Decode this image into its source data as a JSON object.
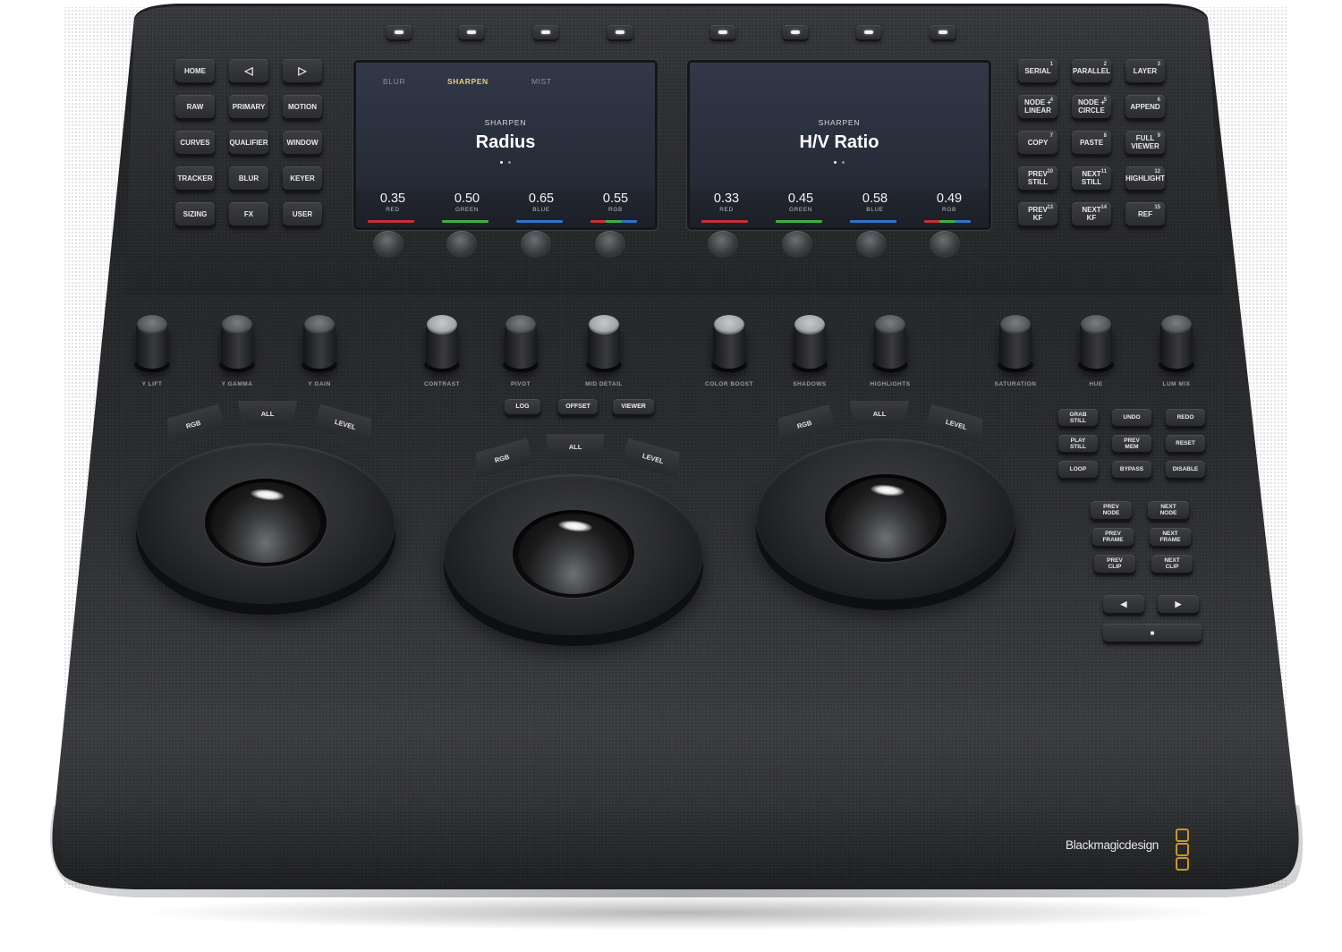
{
  "device": {
    "brand": "Blackmagicdesign",
    "brand_accent_color": "#c9962b",
    "chassis_color": "#2d2e31"
  },
  "top_softkeys": [
    {
      "id": "softkey-1"
    },
    {
      "id": "softkey-2"
    },
    {
      "id": "softkey-3"
    },
    {
      "id": "softkey-4"
    },
    {
      "id": "softkey-5"
    },
    {
      "id": "softkey-6"
    },
    {
      "id": "softkey-7"
    },
    {
      "id": "softkey-8"
    }
  ],
  "left_keypad": [
    {
      "label": "HOME"
    },
    {
      "label": "◁",
      "icon": "left-triangle-icon"
    },
    {
      "label": "▷",
      "icon": "right-triangle-icon"
    },
    {
      "label": "RAW"
    },
    {
      "label": "PRIMARY"
    },
    {
      "label": "MOTION"
    },
    {
      "label": "CURVES"
    },
    {
      "label": "QUALIFIER"
    },
    {
      "label": "WINDOW"
    },
    {
      "label": "TRACKER"
    },
    {
      "label": "BLUR"
    },
    {
      "label": "KEYER"
    },
    {
      "label": "SIZING"
    },
    {
      "label": "FX"
    },
    {
      "label": "USER"
    }
  ],
  "right_keypad": [
    {
      "label": "SERIAL",
      "num": "1"
    },
    {
      "label": "PARALLEL",
      "num": "2"
    },
    {
      "label": "LAYER",
      "num": "3"
    },
    {
      "label": "NODE +\nLINEAR",
      "num": "4"
    },
    {
      "label": "NODE +\nCIRCLE",
      "num": "5"
    },
    {
      "label": "APPEND",
      "num": "6"
    },
    {
      "label": "COPY",
      "num": "7"
    },
    {
      "label": "PASTE",
      "num": "8"
    },
    {
      "label": "FULL\nVIEWER",
      "num": "9"
    },
    {
      "label": "PREV\nSTILL",
      "num": "10"
    },
    {
      "label": "NEXT\nSTILL",
      "num": "11"
    },
    {
      "label": "HIGHLIGHT",
      "num": "12"
    },
    {
      "label": "PREV\nKF",
      "num": "13"
    },
    {
      "label": "NEXT\nKF",
      "num": "14"
    },
    {
      "label": "REF",
      "num": "15"
    }
  ],
  "screens": [
    {
      "tabs": [
        {
          "label": "BLUR",
          "active": false
        },
        {
          "label": "SHARPEN",
          "active": true
        },
        {
          "label": "MIST",
          "active": false
        }
      ],
      "category": "SHARPEN",
      "parameter": "Radius",
      "page_dots": 2,
      "active_page": 1,
      "values": [
        {
          "value": "0.35",
          "channel": "RED"
        },
        {
          "value": "0.50",
          "channel": "GREEN"
        },
        {
          "value": "0.65",
          "channel": "BLUE"
        },
        {
          "value": "0.55",
          "channel": "RGB"
        }
      ]
    },
    {
      "tabs": [],
      "category": "SHARPEN",
      "parameter": "H/V Ratio",
      "page_dots": 2,
      "active_page": 1,
      "values": [
        {
          "value": "0.33",
          "channel": "RED"
        },
        {
          "value": "0.45",
          "channel": "GREEN"
        },
        {
          "value": "0.58",
          "channel": "BLUE"
        },
        {
          "value": "0.49",
          "channel": "RGB"
        }
      ]
    }
  ],
  "channel_colors": {
    "RED": "#c4313a",
    "GREEN": "#3fae3f",
    "BLUE": "#2f74c8"
  },
  "knobs": [
    {
      "label": "Y LIFT"
    },
    {
      "label": "Y GAMMA"
    },
    {
      "label": "Y GAIN"
    },
    {
      "label": "CONTRAST"
    },
    {
      "label": "PIVOT"
    },
    {
      "label": "MID DETAIL"
    },
    {
      "label": "COLOR BOOST"
    },
    {
      "label": "SHADOWS"
    },
    {
      "label": "HIGHLIGHTS"
    },
    {
      "label": "SATURATION"
    },
    {
      "label": "HUE"
    },
    {
      "label": "LUM MIX"
    }
  ],
  "mode_keys": {
    "log": "LOG",
    "offset": "OFFSET",
    "viewer": "VIEWER"
  },
  "wheels": [
    {
      "name": "lift",
      "keys": [
        "RGB",
        "ALL",
        "LEVEL"
      ]
    },
    {
      "name": "gamma",
      "keys": [
        "RGB",
        "ALL",
        "LEVEL"
      ]
    },
    {
      "name": "gain",
      "keys": [
        "RGB",
        "ALL",
        "LEVEL"
      ]
    }
  ],
  "transport_keys": [
    {
      "label": "GRAB\nSTILL"
    },
    {
      "label": "UNDO"
    },
    {
      "label": "REDO"
    },
    {
      "label": "PLAY\nSTILL"
    },
    {
      "label": "PREV\nMEM"
    },
    {
      "label": "RESET"
    },
    {
      "label": "LOOP"
    },
    {
      "label": "BYPASS"
    },
    {
      "label": "DISABLE"
    }
  ],
  "nav_keys": [
    {
      "label": "PREV\nNODE"
    },
    {
      "label": "NEXT\nNODE"
    },
    {
      "label": "PREV\nFRAME"
    },
    {
      "label": "NEXT\nFRAME"
    },
    {
      "label": "PREV\nCLIP"
    },
    {
      "label": "NEXT\nCLIP"
    }
  ],
  "play_keys": {
    "reverse": "◀",
    "forward": "▶",
    "stop": "■"
  }
}
